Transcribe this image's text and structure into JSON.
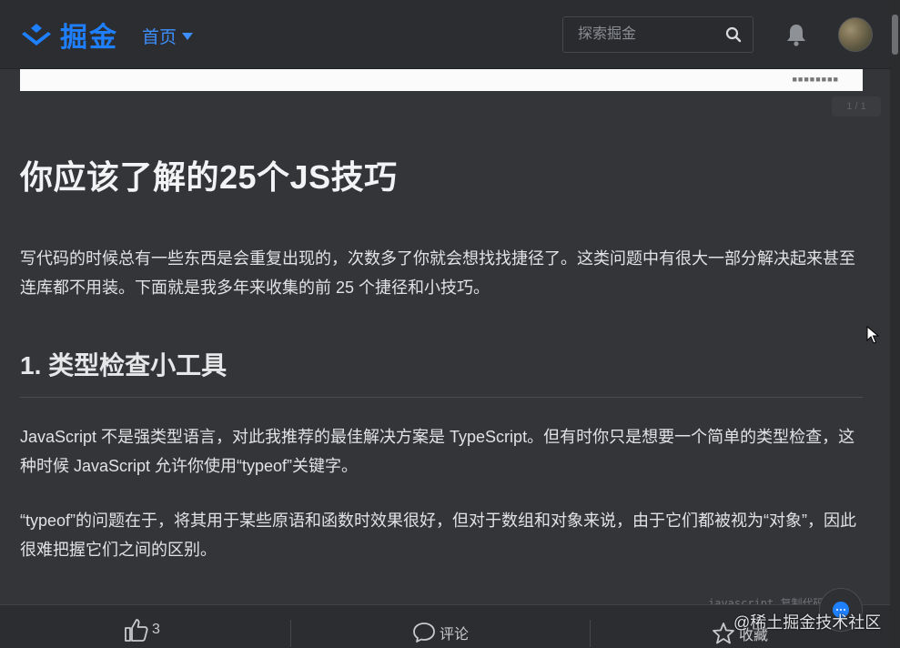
{
  "header": {
    "logo_text": "掘金",
    "nav_home": "首页",
    "search_placeholder": "探索掘金"
  },
  "article": {
    "image_tag": "1 / 1",
    "title": "你应该了解的25个JS技巧",
    "intro": "写代码的时候总有一些东西是会重复出现的，次数多了你就会想找找捷径了。这类问题中有很大一部分解决起来甚至连库都不用装。下面就是我多年来收集的前 25 个捷径和小技巧。",
    "section_heading": "1. 类型检查小工具",
    "para1": "JavaScript 不是强类型语言，对此我推荐的最佳解决方案是 TypeScript。但有时你只是想要一个简单的类型检查，这种时候 JavaScript 允许你使用“typeof”关键字。",
    "para2": "“typeof”的问题在于，将其用于某些原语和函数时效果很好，但对于数组和对象来说，由于它们都被视为“对象”，因此很难把握它们之间的区别。",
    "code_label": "javascript 复制代码"
  },
  "bottom_bar": {
    "like_count": "3",
    "comment_label": "评论",
    "favorite_label": "收藏"
  },
  "watermark": "@稀土掘金技术社区",
  "colors": {
    "brand": "#1e80ff",
    "background": "#343538",
    "header_bg": "#2c2d30"
  }
}
